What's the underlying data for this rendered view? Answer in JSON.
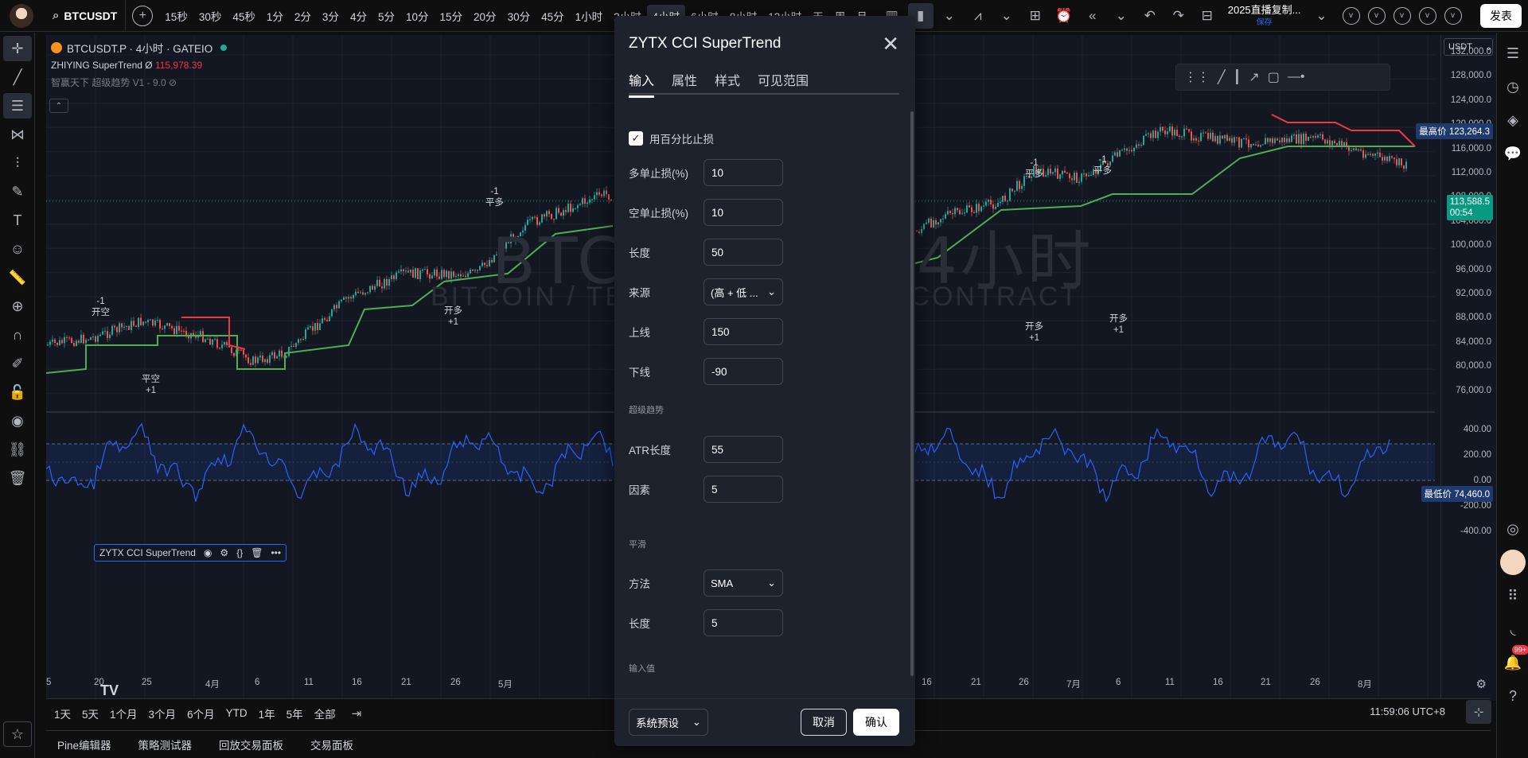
{
  "topbar": {
    "symbol": "BTCUSDT",
    "intervals": [
      "15秒",
      "30秒",
      "45秒",
      "1分",
      "2分",
      "3分",
      "4分",
      "5分",
      "10分",
      "15分",
      "20分",
      "30分",
      "45分",
      "1小时",
      "2小时",
      "4小时",
      "6小时",
      "8小时",
      "12小时",
      "天",
      "周",
      "月"
    ],
    "active_interval": "4小时",
    "layout_name": "2025直播复制...",
    "layout_sub": "保存",
    "publish_label": "发表"
  },
  "chart": {
    "title": "BTCUSDT.P · 4小时 · GATEIO",
    "ind1_name": "ZHIYING SuperTrend",
    "ind1_symbol": "Ø",
    "ind1_value": "115,978.39",
    "ind2_name": "智赢天下 超级趋势 V1 - 9.0",
    "watermark": "BTCUSDT.P, 4小时",
    "watermark_sub": "BITCOIN / TETHER PERPETUAL CONTRACT",
    "currency": "USDT",
    "price_labels": [
      "132,000.0",
      "128,000.0",
      "124,000.0",
      "120,000.0",
      "116,000.0",
      "112,000.0",
      "108,000.0",
      "104,000.0",
      "100,000.0",
      "96,000.0",
      "92,000.0",
      "88,000.0",
      "84,000.0",
      "80,000.0",
      "76,000.0"
    ],
    "high_label": "最高价",
    "high_value": "123,264.3",
    "low_label": "最低价",
    "low_value": "74,460.0",
    "last_price": "113,588.5",
    "countdown": "00:54",
    "osc_labels": [
      "400.00",
      "200.00",
      "0.00",
      "-200.00",
      "-400.00"
    ],
    "osc_name": "ZYTX CCI SuperTrend",
    "x_labels": [
      "5",
      "20",
      "25",
      "4月",
      "6",
      "11",
      "16",
      "21",
      "26",
      "5月",
      "6",
      "11",
      "16",
      "21",
      "26",
      "7月",
      "6",
      "11",
      "16",
      "21",
      "26",
      "8月"
    ],
    "signals": [
      {
        "top": "-1",
        "text": "开空",
        "bottom": ""
      },
      {
        "top": "",
        "text": "平空",
        "bottom": "+1"
      },
      {
        "top": "",
        "text": "开多",
        "bottom": "+1"
      },
      {
        "top": "-1",
        "text": "平多",
        "bottom": ""
      },
      {
        "top": "-1",
        "text": "平多",
        "bottom": ""
      },
      {
        "top": "",
        "text": "开多",
        "bottom": "+1"
      },
      {
        "top": "-1",
        "text": "平多",
        "bottom": ""
      },
      {
        "top": "",
        "text": "开多",
        "bottom": "+1"
      }
    ]
  },
  "rangebar": {
    "ranges": [
      "1天",
      "5天",
      "1个月",
      "3个月",
      "6个月",
      "YTD",
      "1年",
      "5年",
      "全部"
    ],
    "clock": "11:59:06 UTC+8"
  },
  "bottombar": {
    "items": [
      "Pine编辑器",
      "策略测试器",
      "回放交易面板",
      "交易面板"
    ]
  },
  "notif_badge": "99+",
  "dialog": {
    "title": "ZYTX CCI SuperTrend",
    "tabs": [
      "输入",
      "属性",
      "样式",
      "可见范围"
    ],
    "use_percent_label": "用百分比止损",
    "long_sl_label": "多单止损(%)",
    "long_sl_value": "10",
    "short_sl_label": "空单止损(%)",
    "short_sl_value": "10",
    "length_label": "长度",
    "length_value": "50",
    "source_label": "来源",
    "source_value": "(高 + 低 ...",
    "upper_label": "上线",
    "upper_value": "150",
    "lower_label": "下线",
    "lower_value": "-90",
    "section_supertrend": "超级趋势",
    "atr_label": "ATR长度",
    "atr_value": "55",
    "factor_label": "因素",
    "factor_value": "5",
    "section_smooth": "平滑",
    "method_label": "方法",
    "method_value": "SMA",
    "smooth_length_label": "长度",
    "smooth_length_value": "5",
    "section_input": "输入值",
    "preset_label": "系统预设",
    "cancel_label": "取消",
    "ok_label": "确认"
  }
}
